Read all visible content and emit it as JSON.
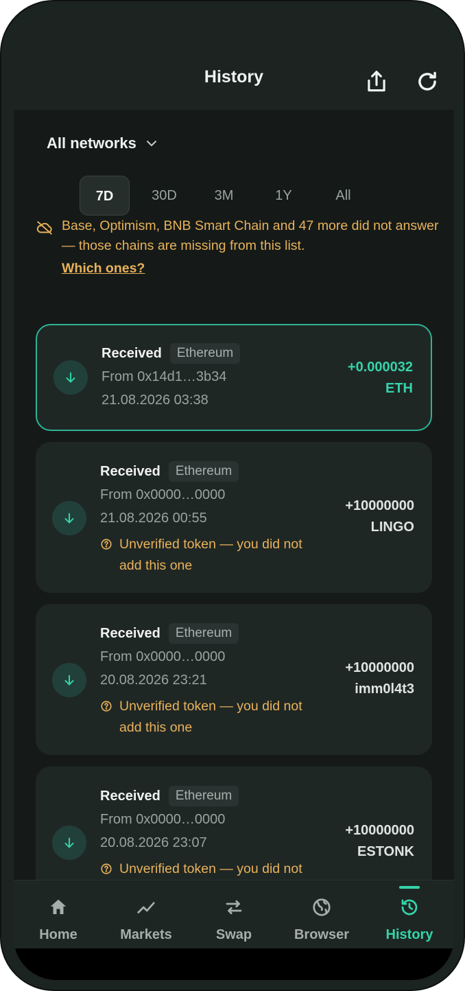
{
  "header": {
    "title": "History"
  },
  "filters": {
    "network": "All networks",
    "periods": [
      "7D",
      "30D",
      "3M",
      "1Y",
      "All"
    ],
    "active_period": "7D"
  },
  "warning": {
    "text": "Base, Optimism, BNB Smart Chain and 47 more did not answer — those chains are missing from this list.",
    "link": "Which ones?"
  },
  "transactions": [
    {
      "type": "Received",
      "network": "Ethereum",
      "from": "From 0x14d1…3b34",
      "date": "21.08.2026  03:38",
      "amount": "+0.000032",
      "token": "ETH",
      "warning": ""
    },
    {
      "type": "Received",
      "network": "Ethereum",
      "from": "From 0x0000…0000",
      "date": "21.08.2026  00:55",
      "amount": "+10000000",
      "token": "LINGO",
      "warning": "Unverified token — you did not add this one"
    },
    {
      "type": "Received",
      "network": "Ethereum",
      "from": "From 0x0000…0000",
      "date": "20.08.2026  23:21",
      "amount": "+10000000",
      "token": "imm0l4t3",
      "warning": "Unverified token — you did not add this one"
    },
    {
      "type": "Received",
      "network": "Ethereum",
      "from": "From 0x0000…0000",
      "date": "20.08.2026  23:07",
      "amount": "+10000000",
      "token": "ESTONK",
      "warning": "Unverified token — you did not add this one"
    }
  ],
  "tabs": [
    {
      "label": "Home",
      "icon": "home-icon"
    },
    {
      "label": "Markets",
      "icon": "chart-line-icon"
    },
    {
      "label": "Swap",
      "icon": "swap-icon"
    },
    {
      "label": "Browser",
      "icon": "globe-icon"
    },
    {
      "label": "History",
      "icon": "history-icon"
    }
  ],
  "colors": {
    "accent": "#35d3a9",
    "warning": "#e9b25a",
    "background": "#151a19"
  }
}
